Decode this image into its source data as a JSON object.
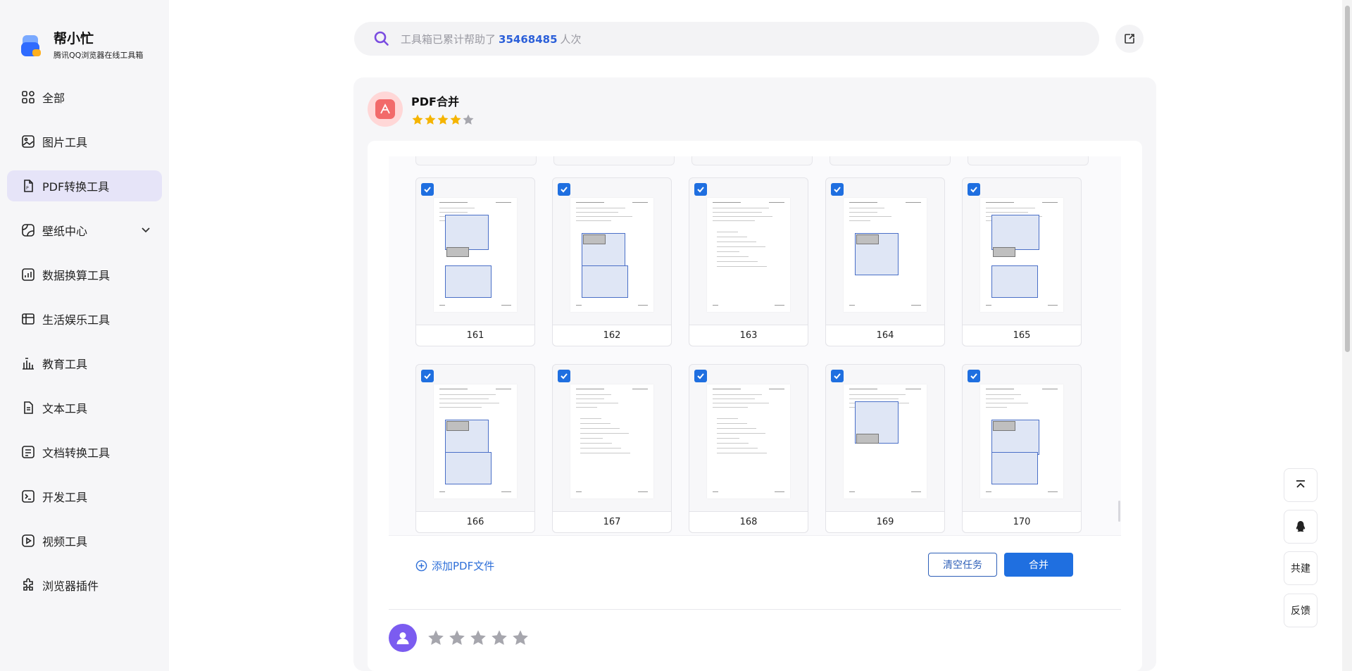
{
  "brand": {
    "name": "帮小忙",
    "subtitle": "腾讯QQ浏览器在线工具箱"
  },
  "sidebar": {
    "items": [
      {
        "label": "全部",
        "icon": "grid-icon"
      },
      {
        "label": "图片工具",
        "icon": "image-icon"
      },
      {
        "label": "PDF转换工具",
        "icon": "pdf-icon",
        "active": true
      },
      {
        "label": "壁纸中心",
        "icon": "wallpaper-icon",
        "expandable": true
      },
      {
        "label": "数据换算工具",
        "icon": "chart-icon"
      },
      {
        "label": "生活娱乐工具",
        "icon": "life-icon"
      },
      {
        "label": "教育工具",
        "icon": "education-icon"
      },
      {
        "label": "文本工具",
        "icon": "text-icon"
      },
      {
        "label": "文档转换工具",
        "icon": "doc-icon"
      },
      {
        "label": "开发工具",
        "icon": "terminal-icon"
      },
      {
        "label": "视频工具",
        "icon": "video-icon"
      },
      {
        "label": "浏览器插件",
        "icon": "plugin-icon"
      }
    ]
  },
  "search": {
    "prefix": "工具箱已累计帮助了",
    "count": "35468485",
    "suffix": "人次"
  },
  "tool": {
    "title": "PDF合并",
    "rating": 4
  },
  "pages": [
    "161",
    "162",
    "163",
    "164",
    "165",
    "166",
    "167",
    "168",
    "169",
    "170"
  ],
  "actions": {
    "add_file": "添加PDF文件",
    "clear": "清空任务",
    "merge": "合并"
  },
  "review": {
    "rating": 0
  },
  "floating": {
    "collab": "共建",
    "feedback": "反馈"
  },
  "colors": {
    "accent": "#1f6fe0",
    "active_nav": "#e6e4f8",
    "star": "#f5b400",
    "star_empty": "#a6a6ad"
  }
}
